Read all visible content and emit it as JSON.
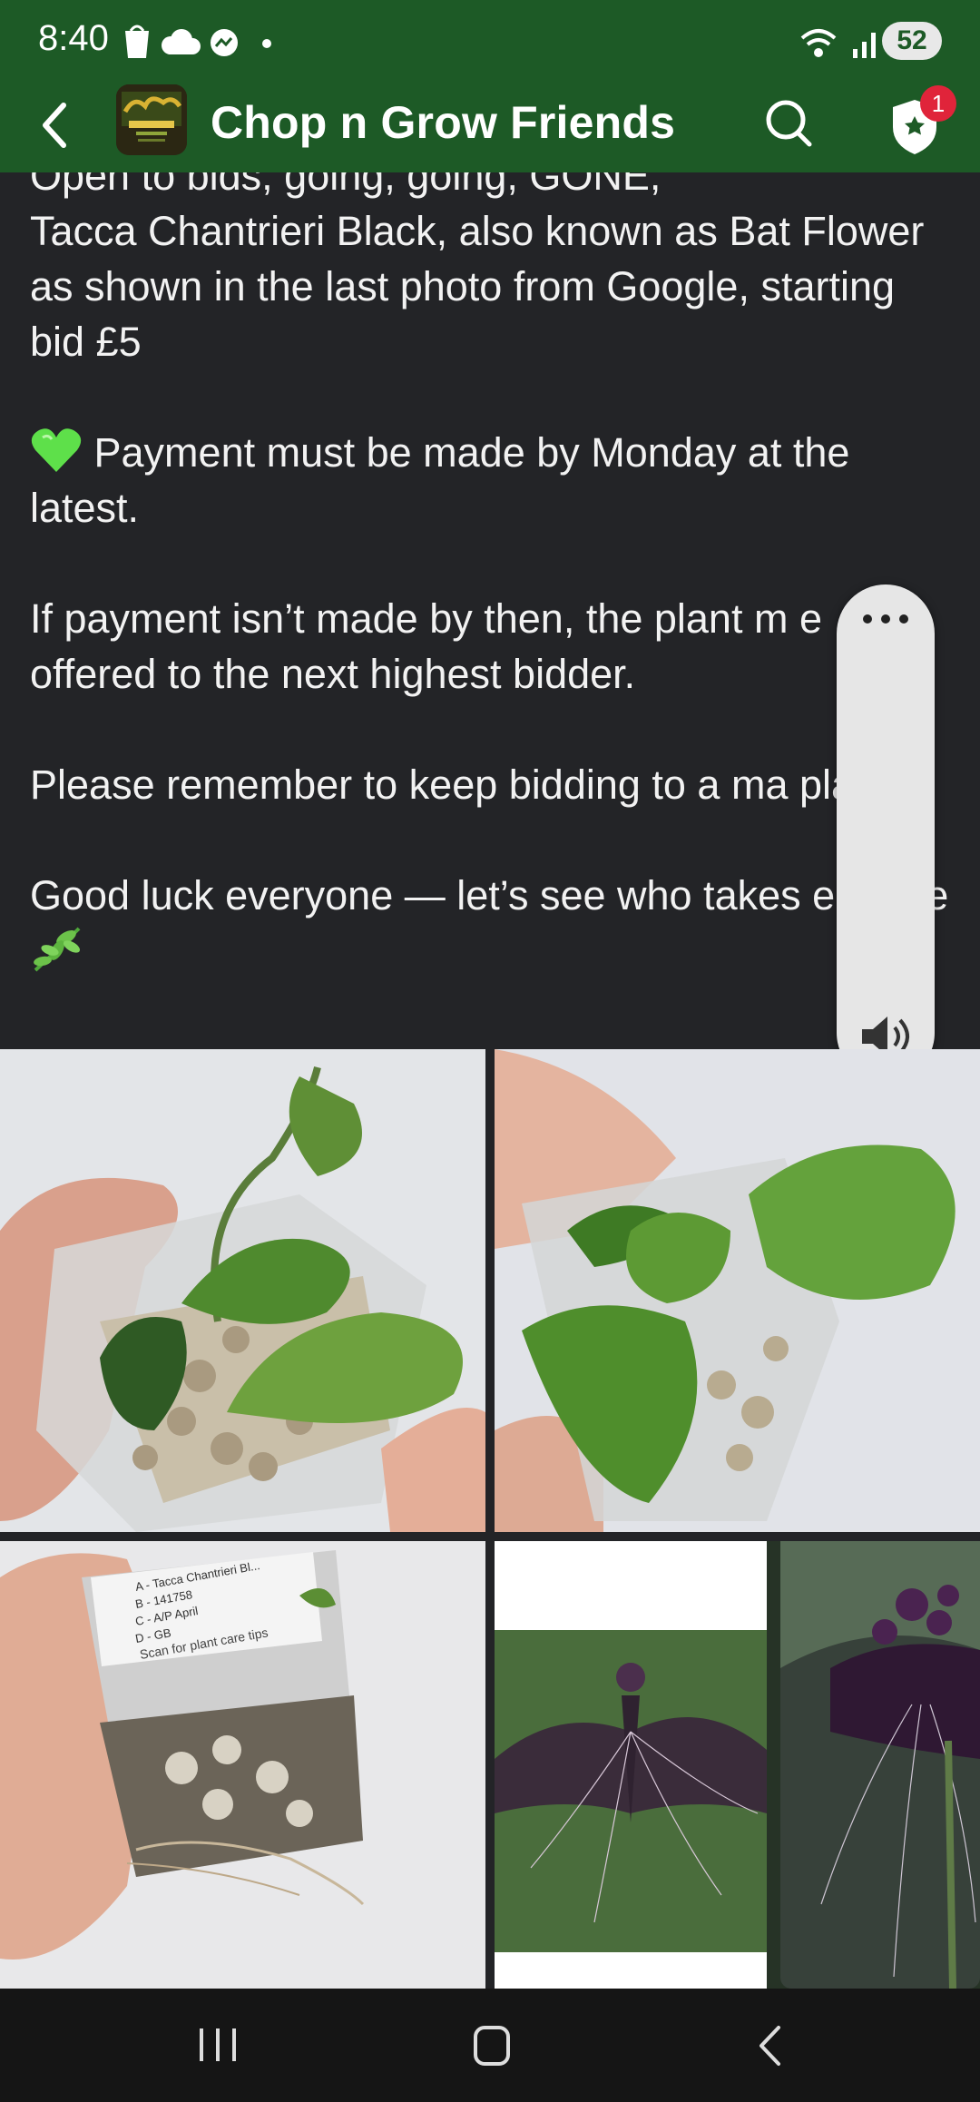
{
  "status": {
    "time": "8:40",
    "battery": "52"
  },
  "header": {
    "title": "Chop n Grow Friends",
    "notif_count": "1"
  },
  "post": {
    "line0": "Open to bids, going, going, GONE,",
    "line1": "Tacca Chantrieri Black,  also known as Bat Flower as shown in the last photo from Google, starting bid £5",
    "line2": "Payment must be made by Monday at the latest.",
    "line3": "If payment isn’t made by then, the plant m     e offered to the next highest bidder.",
    "line4": "Please remember to keep bidding to a ma      plants.",
    "line5": "Good luck everyone — let’s see who takes        e home"
  },
  "photo3_label": {
    "a": "A - Tacca Chantrieri Bl...",
    "b": "B - 141758",
    "c": "C - A/P April",
    "d": "D - GB",
    "scan": "Scan for plant care tips"
  },
  "colors": {
    "header_green": "#1d5a26",
    "background": "#232427",
    "badge_red": "#e0243a"
  }
}
